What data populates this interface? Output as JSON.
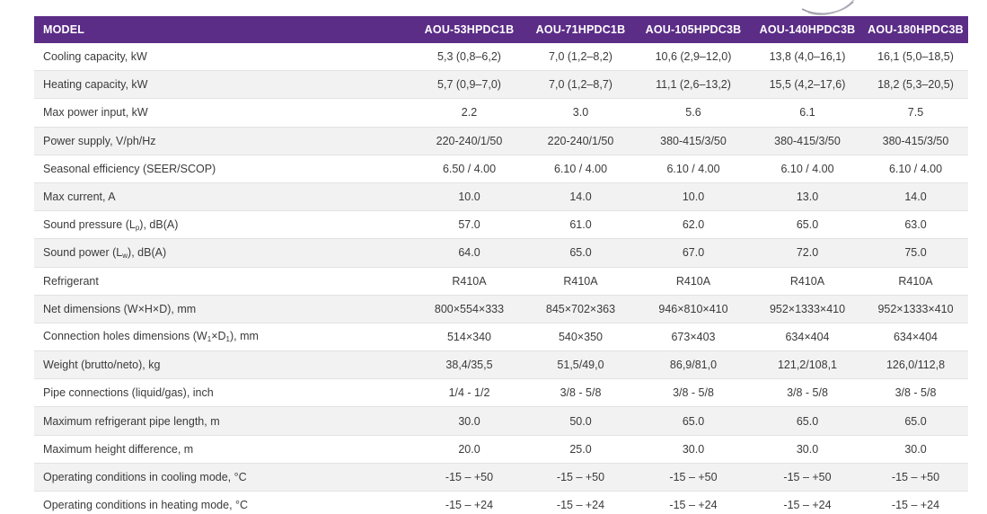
{
  "table": {
    "header": {
      "label": "MODEL",
      "models": [
        "AOU-53HPDC1B",
        "AOU-71HPDC1B",
        "AOU-105HPDC3B",
        "AOU-140HPDC3B",
        "AOU-180HPDC3B"
      ]
    },
    "rows": [
      {
        "label": "Cooling capacity, kW",
        "values": [
          "5,3 (0,8–6,2)",
          "7,0 (1,2–8,2)",
          "10,6 (2,9–12,0)",
          "13,8 (4,0–16,1)",
          "16,1 (5,0–18,5)"
        ]
      },
      {
        "label": "Heating capacity, kW",
        "values": [
          "5,7 (0,9–7,0)",
          "7,0 (1,2–8,7)",
          "11,1 (2,6–13,2)",
          "15,5 (4,2–17,6)",
          "18,2 (5,3–20,5)"
        ]
      },
      {
        "label": "Max power input, kW",
        "values": [
          "2.2",
          "3.0",
          "5.6",
          "6.1",
          "7.5"
        ]
      },
      {
        "label": "Power supply, V/ph/Hz",
        "values": [
          "220-240/1/50",
          "220-240/1/50",
          "380-415/3/50",
          "380-415/3/50",
          "380-415/3/50"
        ]
      },
      {
        "label": "Seasonal efficiency (SEER/SCOP)",
        "values": [
          "6.50 / 4.00",
          "6.10 / 4.00",
          "6.10 / 4.00",
          "6.10 / 4.00",
          "6.10 / 4.00"
        ]
      },
      {
        "label": "Max current, A",
        "values": [
          "10.0",
          "14.0",
          "10.0",
          "13.0",
          "14.0"
        ]
      },
      {
        "label_parts": [
          "Sound pressure (L",
          "p",
          "), dB(A)"
        ],
        "values": [
          "57.0",
          "61.0",
          "62.0",
          "65.0",
          "63.0"
        ]
      },
      {
        "label_parts": [
          "Sound power (L",
          "w",
          "), dB(A)"
        ],
        "values": [
          "64.0",
          "65.0",
          "67.0",
          "72.0",
          "75.0"
        ]
      },
      {
        "label": "Refrigerant",
        "values": [
          "R410A",
          "R410A",
          "R410A",
          "R410A",
          "R410A"
        ]
      },
      {
        "label": "Net dimensions (W×H×D), mm",
        "values": [
          "800×554×333",
          "845×702×363",
          "946×810×410",
          "952×1333×410",
          "952×1333×410"
        ]
      },
      {
        "label_parts": [
          "Connection holes dimensions (W",
          "1",
          "×D",
          "1",
          "), mm"
        ],
        "values": [
          "514×340",
          "540×350",
          "673×403",
          "634×404",
          "634×404"
        ]
      },
      {
        "label": "Weight (brutto/neto), kg",
        "values": [
          "38,4/35,5",
          "51,5/49,0",
          "86,9/81,0",
          "121,2/108,1",
          "126,0/112,8"
        ]
      },
      {
        "label": "Pipe connections (liquid/gas), inch",
        "values": [
          "1/4 - 1/2",
          "3/8 - 5/8",
          "3/8 - 5/8",
          "3/8 - 5/8",
          "3/8 - 5/8"
        ]
      },
      {
        "label": "Maximum refrigerant pipe length, m",
        "values": [
          "30.0",
          "50.0",
          "65.0",
          "65.0",
          "65.0"
        ]
      },
      {
        "label": "Maximum height difference, m",
        "values": [
          "20.0",
          "25.0",
          "30.0",
          "30.0",
          "30.0"
        ]
      },
      {
        "label": "Operating conditions in cooling mode, °C",
        "values": [
          "-15 – +50",
          "-15 – +50",
          "-15 – +50",
          "-15 – +50",
          "-15 – +50"
        ]
      },
      {
        "label": "Operating conditions in heating mode, °C",
        "values": [
          "-15 – +24",
          "-15 – +24",
          "-15 – +24",
          "-15 – +24",
          "-15 – +24"
        ]
      }
    ]
  },
  "colors": {
    "header_bg": "#5b2d87",
    "header_text": "#ffffff",
    "row_alt": "#f2f2f2",
    "text": "#3a3a3a"
  }
}
